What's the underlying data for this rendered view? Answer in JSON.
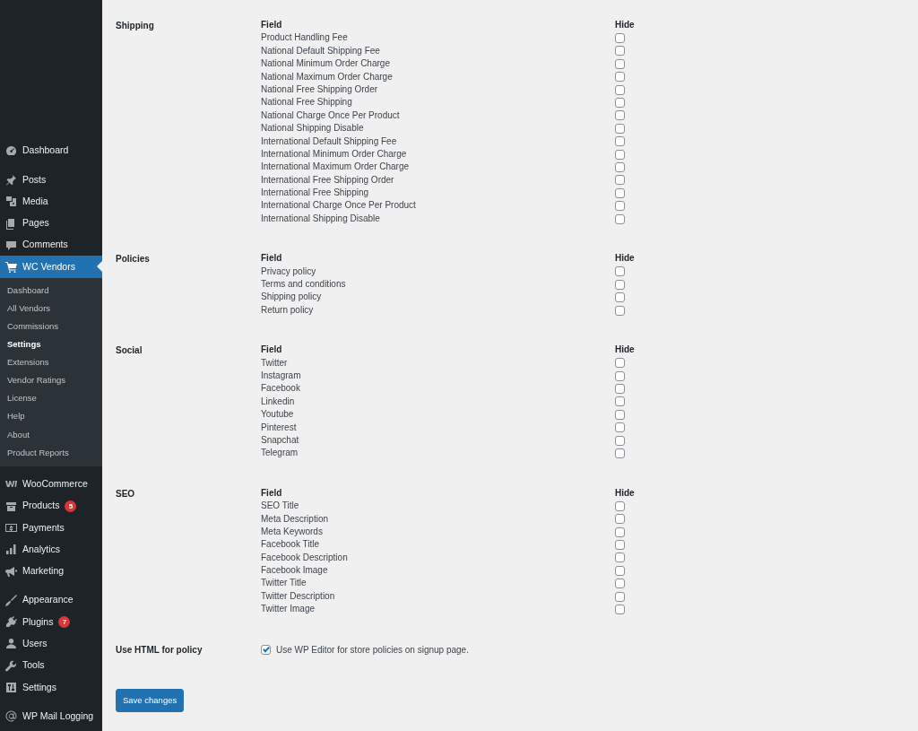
{
  "sidebar": {
    "groups": [
      [
        {
          "label": "Dashboard",
          "selected": false
        }
      ],
      [
        {
          "label": "Posts",
          "selected": false
        },
        {
          "label": "Media",
          "selected": false
        },
        {
          "label": "Pages",
          "selected": false
        },
        {
          "label": "Comments",
          "selected": false
        },
        {
          "label": "WC Vendors",
          "selected": true,
          "submenu": [
            {
              "label": "Dashboard",
              "selected": false
            },
            {
              "label": "All Vendors",
              "selected": false
            },
            {
              "label": "Commissions",
              "selected": false
            },
            {
              "label": "Settings",
              "selected": true
            },
            {
              "label": "Extensions",
              "selected": false
            },
            {
              "label": "Vendor Ratings",
              "selected": false
            },
            {
              "label": "License",
              "selected": false
            },
            {
              "label": "Help",
              "selected": false
            },
            {
              "label": "About",
              "selected": false
            },
            {
              "label": "Product Reports",
              "selected": false
            }
          ]
        }
      ],
      [
        {
          "label": "WooCommerce",
          "selected": false
        },
        {
          "label": "Products",
          "selected": false,
          "badge": "5"
        },
        {
          "label": "Payments",
          "selected": false
        },
        {
          "label": "Analytics",
          "selected": false
        },
        {
          "label": "Marketing",
          "selected": false
        }
      ],
      [
        {
          "label": "Appearance",
          "selected": false
        },
        {
          "label": "Plugins",
          "selected": false,
          "badge": "7"
        },
        {
          "label": "Users",
          "selected": false
        },
        {
          "label": "Tools",
          "selected": false
        },
        {
          "label": "Settings",
          "selected": false
        }
      ],
      [
        {
          "label": "WP Mail Logging",
          "selected": false
        }
      ]
    ]
  },
  "sections": [
    {
      "title": "Shipping",
      "kind": "fields",
      "field_header": "Field",
      "hide_header": "Hide",
      "rows": [
        {
          "label": "Product Handling Fee",
          "checked": false
        },
        {
          "label": "National Default Shipping Fee",
          "checked": false
        },
        {
          "label": "National Minimum Order Charge",
          "checked": false
        },
        {
          "label": "National Maximum Order Charge",
          "checked": false
        },
        {
          "label": "National Free Shipping Order",
          "checked": false
        },
        {
          "label": "National Free Shipping",
          "checked": false
        },
        {
          "label": "National Charge Once Per Product",
          "checked": false
        },
        {
          "label": "National Shipping Disable",
          "checked": false
        },
        {
          "label": "International Default Shipping Fee",
          "checked": false
        },
        {
          "label": "International Minimum Order Charge",
          "checked": false
        },
        {
          "label": "International Maximum Order Charge",
          "checked": false
        },
        {
          "label": "International Free Shipping Order",
          "checked": false
        },
        {
          "label": "International Free Shipping",
          "checked": false
        },
        {
          "label": "International Charge Once Per Product",
          "checked": false
        },
        {
          "label": "International Shipping Disable",
          "checked": false
        }
      ]
    },
    {
      "title": "Policies",
      "kind": "fields",
      "field_header": "Field",
      "hide_header": "Hide",
      "rows": [
        {
          "label": "Privacy policy",
          "checked": false
        },
        {
          "label": "Terms and conditions",
          "checked": false
        },
        {
          "label": "Shipping policy",
          "checked": false
        },
        {
          "label": "Return policy",
          "checked": false
        }
      ]
    },
    {
      "title": "Social",
      "kind": "fields",
      "field_header": "Field",
      "hide_header": "Hide",
      "rows": [
        {
          "label": "Twitter",
          "checked": false
        },
        {
          "label": "Instagram",
          "checked": false
        },
        {
          "label": "Facebook",
          "checked": false
        },
        {
          "label": "Linkedin",
          "checked": false
        },
        {
          "label": "Youtube",
          "checked": false
        },
        {
          "label": "Pinterest",
          "checked": false
        },
        {
          "label": "Snapchat",
          "checked": false
        },
        {
          "label": "Telegram",
          "checked": false
        }
      ]
    },
    {
      "title": "SEO",
      "kind": "fields",
      "field_header": "Field",
      "hide_header": "Hide",
      "rows": [
        {
          "label": "SEO Title",
          "checked": false
        },
        {
          "label": "Meta Description",
          "checked": false
        },
        {
          "label": "Meta Keywords",
          "checked": false
        },
        {
          "label": "Facebook Title",
          "checked": false
        },
        {
          "label": "Facebook Description",
          "checked": false
        },
        {
          "label": "Facebook Image",
          "checked": false
        },
        {
          "label": "Twitter Title",
          "checked": false
        },
        {
          "label": "Twitter Description",
          "checked": false
        },
        {
          "label": "Twitter Image",
          "checked": false
        }
      ]
    },
    {
      "title": "Use HTML for policy",
      "kind": "checkbox",
      "label": "Use WP Editor for store policies on signup page.",
      "checked": true
    }
  ],
  "save_button": "Save changes"
}
